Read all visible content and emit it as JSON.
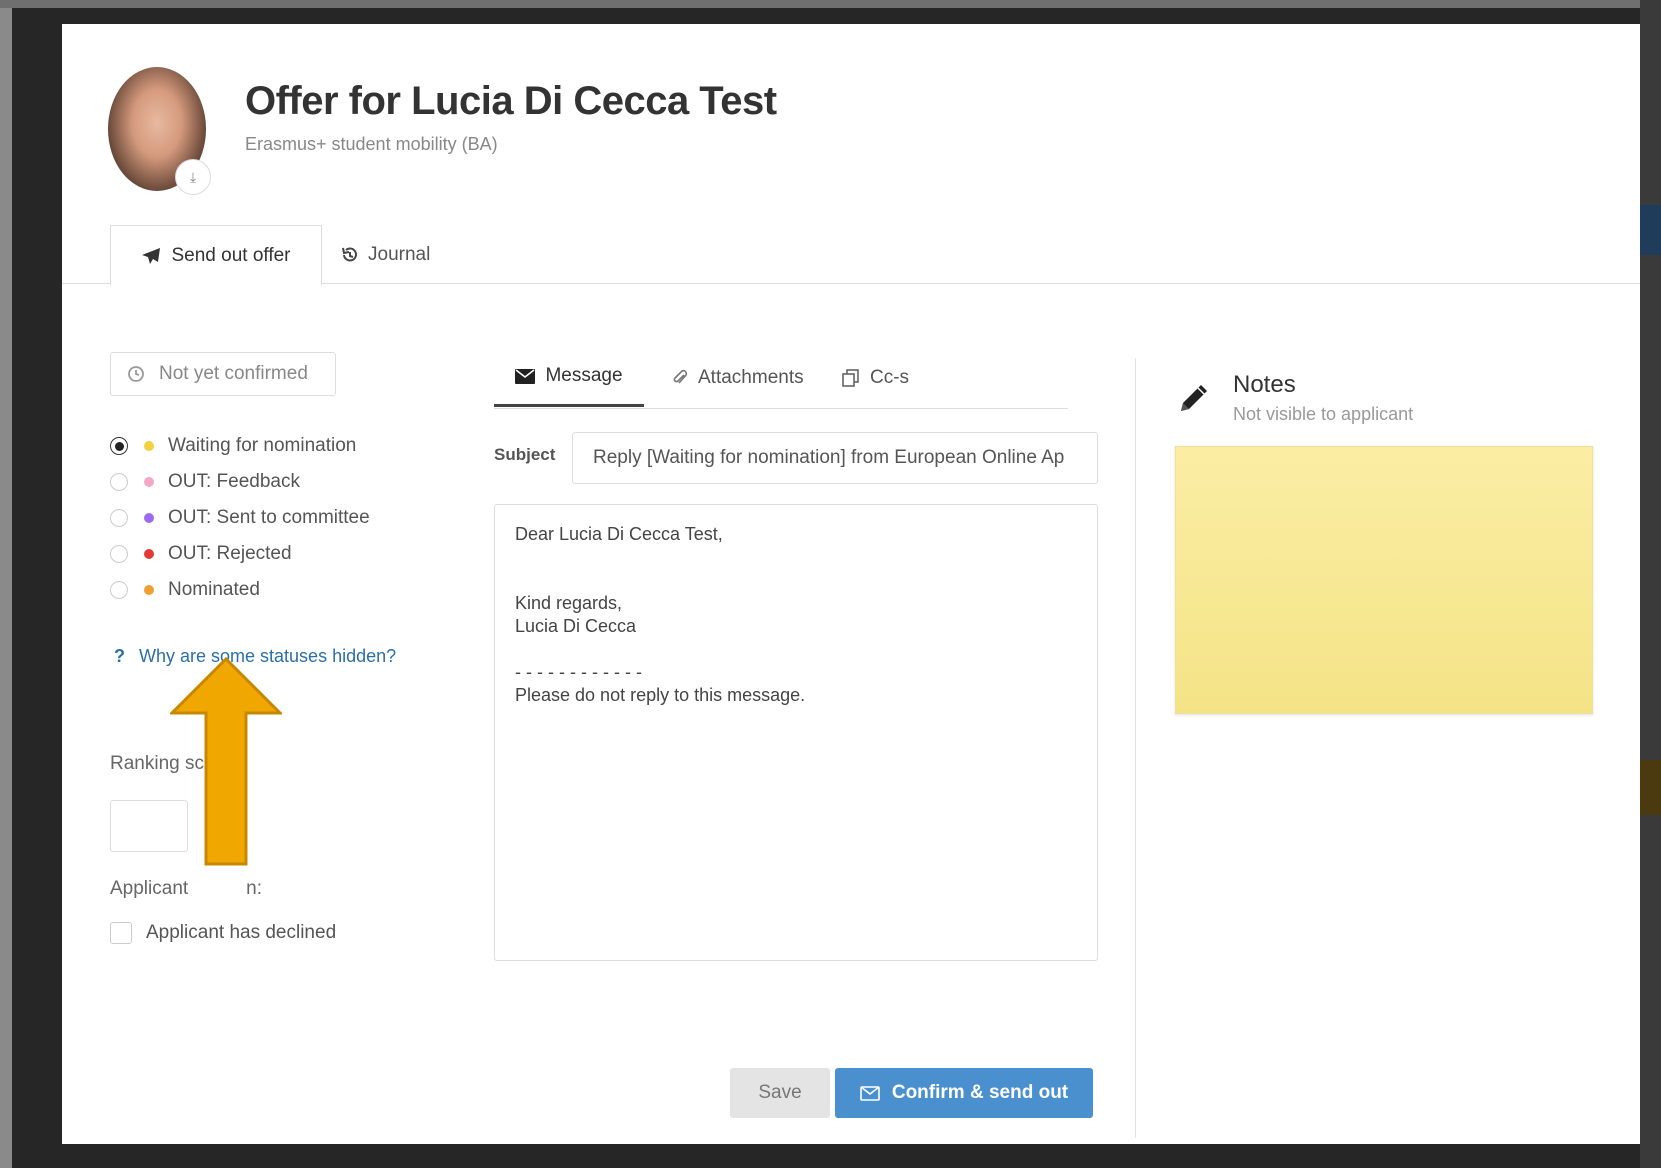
{
  "header": {
    "title": "Offer for Lucia Di Cecca Test",
    "subtitle": "Erasmus+ student mobility (BA)"
  },
  "tabs": [
    {
      "label": "Send out offer",
      "icon": "paper-plane-icon",
      "active": true
    },
    {
      "label": "Journal",
      "icon": "history-icon",
      "active": false
    }
  ],
  "status": {
    "button_label": "Not yet confirmed",
    "options": [
      {
        "label": "Waiting for nomination",
        "color": "#f4d03f",
        "checked": true
      },
      {
        "label": "OUT: Feedback",
        "color": "#f5a7c8",
        "checked": false
      },
      {
        "label": "OUT: Sent to committee",
        "color": "#9b6cf0",
        "checked": false
      },
      {
        "label": "OUT: Rejected",
        "color": "#e53935",
        "checked": false
      },
      {
        "label": "Nominated",
        "color": "#f0a030",
        "checked": false
      }
    ],
    "help_link": "Why are some statuses hidden?",
    "help_icon": "?"
  },
  "ranking": {
    "label": "Ranking sc",
    "value": ""
  },
  "decision": {
    "label": "Applicant",
    "label_end": "n:",
    "checkbox_label": "Applicant has declined",
    "checked": false
  },
  "message": {
    "tabs": [
      {
        "label": "Message",
        "icon": "envelope-icon",
        "active": true
      },
      {
        "label": "Attachments",
        "icon": "paperclip-icon",
        "active": false
      },
      {
        "label": "Cc-s",
        "icon": "copy-icon",
        "active": false
      }
    ],
    "subject_label": "Subject",
    "subject_value": "Reply [Waiting for nomination] from European Online Ap",
    "body_lines": [
      "Dear Lucia Di Cecca Test,",
      "",
      "",
      "Kind regards,",
      "Lucia Di Cecca",
      "",
      "- - - - - - - - - - - -",
      "Please do not reply to this message."
    ]
  },
  "actions": {
    "save_label": "Save",
    "send_label": "Confirm & send out"
  },
  "notes": {
    "title": "Notes",
    "subtitle": "Not visible to applicant",
    "value": ""
  },
  "annotation": {
    "arrow_color": "#f0a800"
  }
}
